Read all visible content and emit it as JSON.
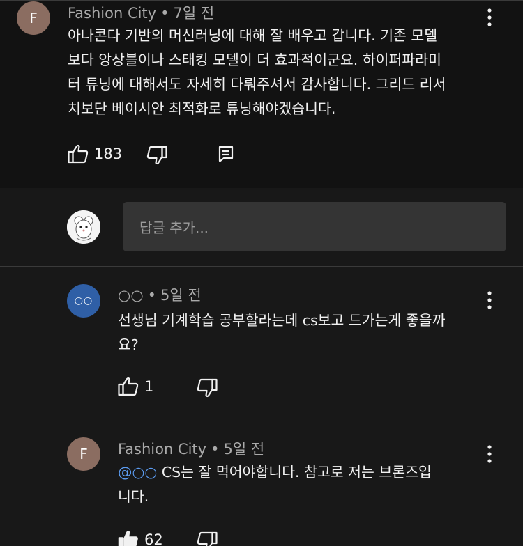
{
  "main_comment": {
    "avatar_letter": "F",
    "author": "Fashion City",
    "time": "7일 전",
    "text_lines": [
      "아나콘다 기반의 머신러닝에 대해 잘 배우고 갑니다. 기존 모델",
      "보다 앙상블이나 스태킹 모델이 더 효과적이군요. 하이퍼파라미",
      "터 튜닝에 대해서도 자세히 다뤄주셔서 감사합니다. 그리드 리서",
      "치보단  베이시안 최적화로 튜닝해야겠습니다."
    ],
    "likes": "183"
  },
  "reply_box": {
    "placeholder": "답글 추가..."
  },
  "replies": [
    {
      "avatar_letter": "○○",
      "author": "○○",
      "time": "5일 전",
      "text_lines": [
        "선생님 기계학습 공부할라는데 cs보고 드가는게 좋을까",
        "요?"
      ],
      "likes": "1"
    },
    {
      "avatar_letter": "F",
      "author": "Fashion City",
      "time": "5일 전",
      "mention": "@○○",
      "text_first_line_rest": "CS는 잘 먹어야합니다. 참고로 저는 브론즈입",
      "text_second_line": "니다.",
      "likes": "62"
    }
  ],
  "colors": {
    "main_bg": "#121212",
    "page_bg": "#181818",
    "input_bg": "#343434",
    "mention": "#5b9bf0",
    "avatar_f": "#8b6d61",
    "avatar_o": "#2f5fa6"
  },
  "icons": [
    "thumbs-up-icon",
    "thumbs-down-icon",
    "reply-icon",
    "more-vert-icon"
  ]
}
